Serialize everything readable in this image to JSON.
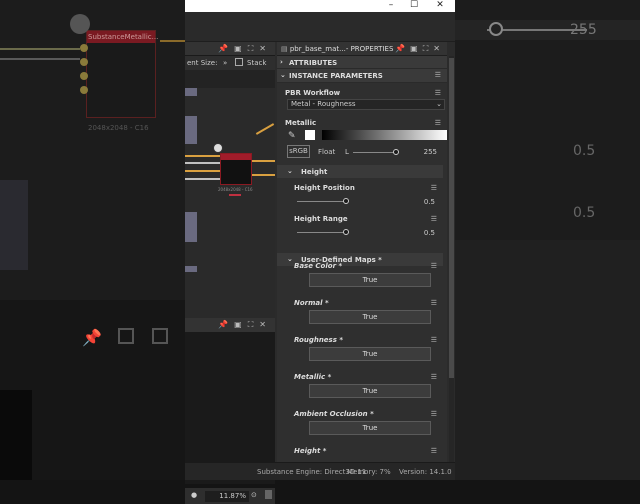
{
  "background": {
    "left_node_label": "SubstanceMetallic...",
    "left_node_res": "2048x2048 - C16",
    "right_value_top": "255",
    "right_value_mid1": "0.5",
    "right_value_mid2": "0.5"
  },
  "window": {
    "minimize": "–",
    "maximize": "☐",
    "close": "✕"
  },
  "graph": {
    "toolbar_size_label": "ent Size:",
    "stack_label": "Stack",
    "zoom": "11.87%",
    "node_res": "2048x2048 - C16"
  },
  "properties": {
    "title": "pbr_base_mat...- PROPERTIES",
    "attributes": "ATTRIBUTES",
    "instance_parameters": "INSTANCE PARAMETERS",
    "pbr_workflow_label": "PBR Workflow",
    "pbr_workflow_value": "Metal - Roughness",
    "metallic_label": "Metallic",
    "srgb_label": "sRGB",
    "float_label": "Float",
    "l_label": "L",
    "metallic_value": "255",
    "height_section": "Height",
    "height_position_label": "Height Position",
    "height_position_value": "0.5",
    "height_range_label": "Height Range",
    "height_range_value": "0.5",
    "user_maps_section": "User-Defined Maps *",
    "maps": [
      {
        "label": "Base Color *",
        "value": "True"
      },
      {
        "label": "Normal *",
        "value": "True"
      },
      {
        "label": "Roughness *",
        "value": "True"
      },
      {
        "label": "Metallic *",
        "value": "True"
      },
      {
        "label": "Ambient Occlusion *",
        "value": "True"
      },
      {
        "label": "Height *",
        "value": ""
      }
    ]
  },
  "status": {
    "engine": "Substance Engine: Direct3D 11",
    "memory": "Memory: 7%",
    "version": "Version: 14.1.0"
  }
}
